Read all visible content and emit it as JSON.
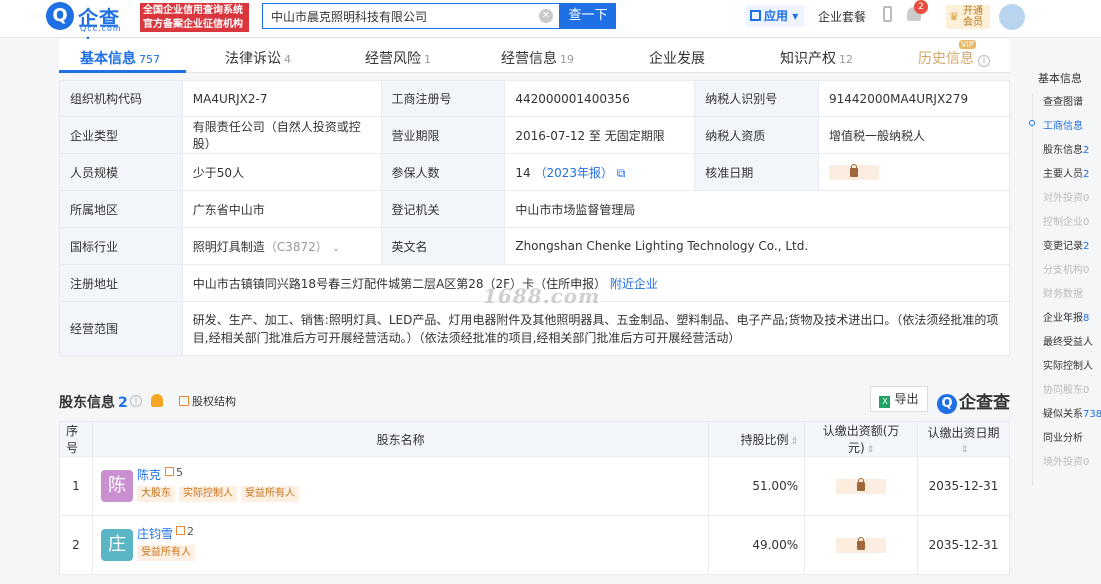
{
  "header": {
    "logo_mark": "Q",
    "logo_name": "企查查",
    "logo_domain": "Qcc.com",
    "badge_line1": "全国企业信用查询系统",
    "badge_line2": "官方备案企业征信机构",
    "search_value": "中山市晨克照明科技有限公司",
    "search_button": "查一下",
    "apps_label": "应用",
    "enterprise_pkg": "企业套餐",
    "notif_count": "2",
    "vip_line1": "开通",
    "vip_line2": "会员"
  },
  "tabs": [
    {
      "label": "基本信息",
      "count": "757"
    },
    {
      "label": "法律诉讼",
      "count": "4"
    },
    {
      "label": "经营风险",
      "count": "1"
    },
    {
      "label": "经营信息",
      "count": "19"
    },
    {
      "label": "企业发展",
      "count": ""
    },
    {
      "label": "知识产权",
      "count": "12"
    },
    {
      "label": "历史信息",
      "count": ""
    }
  ],
  "vip_tag": "VIP",
  "info": {
    "org_code_label": "组织机构代码",
    "org_code": "MA4URJX2-7",
    "reg_no_label": "工商注册号",
    "reg_no": "442000001400356",
    "tax_id_label": "纳税人识别号",
    "tax_id": "91442000MA4URJX279",
    "type_label": "企业类型",
    "type": "有限责任公司（自然人投资或控股）",
    "term_label": "营业期限",
    "term": "2016-07-12 至 无固定期限",
    "tax_qual_label": "纳税人资质",
    "tax_qual": "增值税一般纳税人",
    "staff_label": "人员规模",
    "staff": "少于50人",
    "insured_label": "参保人数",
    "insured": "14",
    "insured_year": "（2023年报）",
    "approval_label": "核准日期",
    "region_label": "所属地区",
    "region": "广东省中山市",
    "authority_label": "登记机关",
    "authority": "中山市市场监督管理局",
    "industry_label": "国标行业",
    "industry": "照明灯具制造",
    "industry_code": "（C3872）",
    "en_name_label": "英文名",
    "en_name": "Zhongshan Chenke Lighting Technology Co., Ltd.",
    "address_label": "注册地址",
    "address": "中山市古镇镇同兴路18号春三灯配件城第二层A区第28（2F）卡（住所申报）",
    "address_link": "附近企业",
    "scope_label": "经营范围",
    "scope": "研发、生产、加工、销售:照明灯具、LED产品、灯用电器附件及其他照明器具、五金制品、塑料制品、电子产品;货物及技术进出口。（依法须经批准的项目,经相关部门批准后方可开展经营活动。）（依法须经批准的项目,经相关部门批准后方可开展经营活动）"
  },
  "watermark": "1688.com",
  "shareholders": {
    "title": "股东信息",
    "count": "2",
    "struct_label": "股权结构",
    "export_label": "导出",
    "brand_label": "企查查",
    "columns": [
      "序号",
      "股东名称",
      "持股比例",
      "认缴出资额(万元)",
      "认缴出资日期"
    ],
    "rows": [
      {
        "no": "1",
        "avatar": "陈",
        "name": "陈克",
        "rel": "5",
        "tags": [
          "大股东",
          "实际控制人",
          "受益所有人"
        ],
        "ratio": "51.00%",
        "date": "2035-12-31",
        "color": "#c98fd1"
      },
      {
        "no": "2",
        "avatar": "庄",
        "name": "庄钧雪",
        "rel": "2",
        "tags": [
          "受益所有人"
        ],
        "ratio": "49.00%",
        "date": "2035-12-31",
        "color": "#5ab5c5"
      }
    ]
  },
  "sidenav": {
    "head": "基本信息",
    "items": [
      {
        "label": "查查图谱",
        "n": "",
        "state": "normal"
      },
      {
        "label": "工商信息",
        "n": "",
        "state": "active"
      },
      {
        "label": "股东信息",
        "n": "2",
        "state": "normal"
      },
      {
        "label": "主要人员",
        "n": "2",
        "state": "normal"
      },
      {
        "label": "对外投资",
        "n": "0",
        "state": "disabled"
      },
      {
        "label": "控制企业",
        "n": "0",
        "state": "disabled"
      },
      {
        "label": "变更记录",
        "n": "2",
        "state": "normal"
      },
      {
        "label": "分支机构",
        "n": "0",
        "state": "disabled"
      },
      {
        "label": "财务数据",
        "n": "",
        "state": "disabled"
      },
      {
        "label": "企业年报",
        "n": "8",
        "state": "normal"
      },
      {
        "label": "最终受益人",
        "n": "",
        "state": "normal"
      },
      {
        "label": "实际控制人",
        "n": "",
        "state": "normal"
      },
      {
        "label": "协同股东",
        "n": "0",
        "state": "disabled"
      },
      {
        "label": "疑似关系",
        "n": "738",
        "state": "normal"
      },
      {
        "label": "同业分析",
        "n": "",
        "state": "normal"
      },
      {
        "label": "境外投资",
        "n": "0",
        "state": "disabled"
      }
    ]
  }
}
